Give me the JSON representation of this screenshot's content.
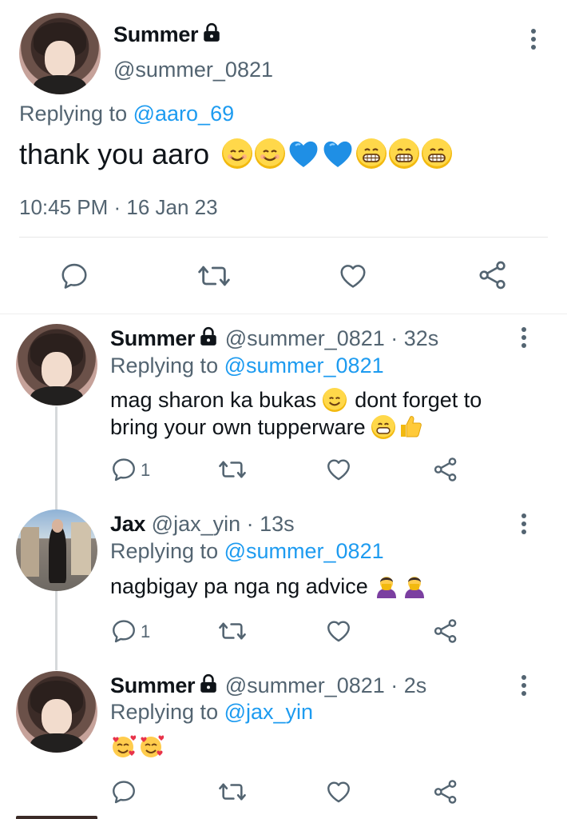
{
  "main_tweet": {
    "name": "Summer",
    "handle": "@summer_0821",
    "replying_prefix": "Replying to",
    "replying_to": "@aaro_69",
    "text": "thank you aaro",
    "emojis": [
      "smile-emoji",
      "smile-emoji",
      "blue-heart-emoji",
      "blue-heart-emoji",
      "grin-emoji",
      "grin-emoji",
      "grin-emoji"
    ],
    "timestamp": "10:45 PM · 16 Jan 23"
  },
  "replies": [
    {
      "name": "Summer",
      "handle": "@summer_0821",
      "time": "· 32s",
      "replying_prefix": "Replying to",
      "replying_to": "@summer_0821",
      "text_line1": "mag sharon ka bukas",
      "text_line1b": "dont forget to",
      "text_line2": "bring your own tupperware",
      "reply_count": "1"
    },
    {
      "name": "Jax",
      "handle": "@jax_yin",
      "time": "· 13s",
      "replying_prefix": "Replying to",
      "replying_to": "@summer_0821",
      "text_line1": "nagbigay pa nga ng advice",
      "reply_count": "1"
    },
    {
      "name": "Summer",
      "handle": "@summer_0821",
      "time": "· 2s",
      "replying_prefix": "Replying to",
      "replying_to": "@jax_yin",
      "reply_count": ""
    }
  ],
  "colors": {
    "link": "#1d9bf0",
    "muted": "#536471",
    "text": "#0f1419"
  }
}
